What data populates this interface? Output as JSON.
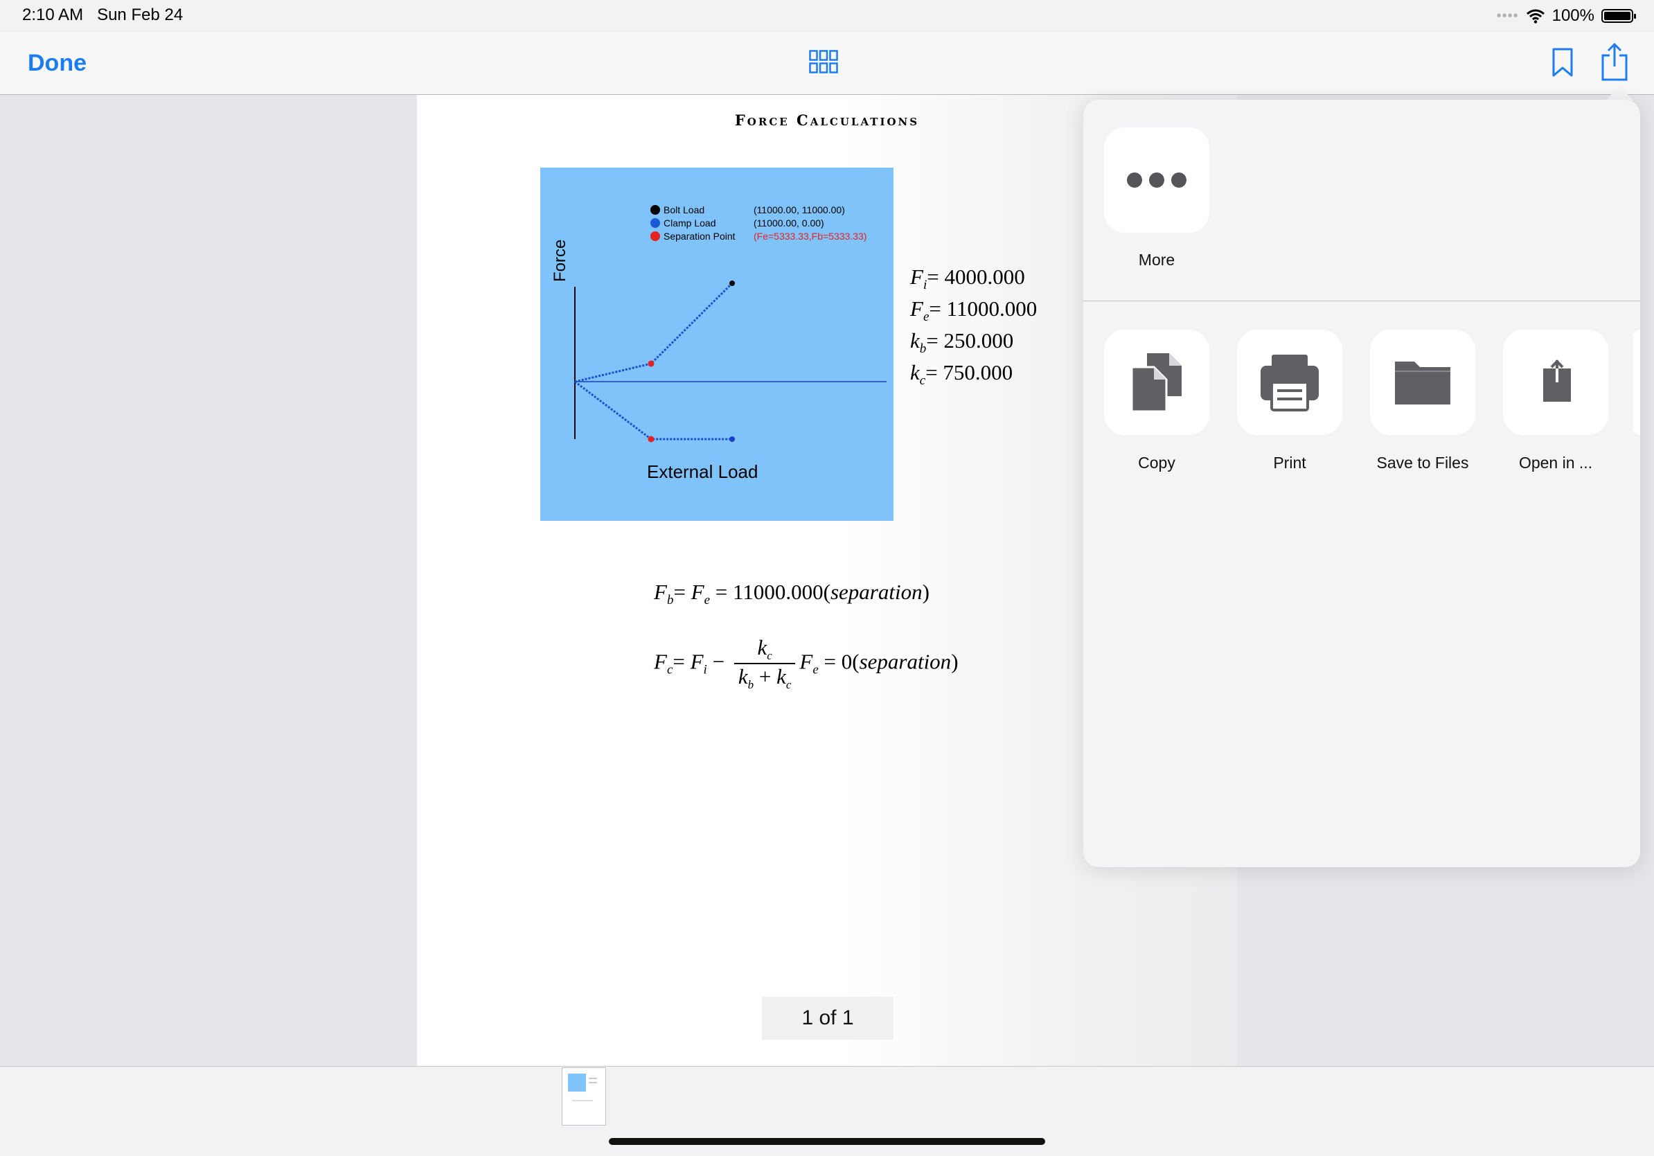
{
  "status": {
    "time": "2:10 AM",
    "date": "Sun Feb 24",
    "battery": "100%"
  },
  "nav": {
    "done": "Done",
    "icons": [
      "grid-icon",
      "bookmark-icon",
      "share-icon"
    ]
  },
  "doc": {
    "title": "Force Calculations",
    "plot": {
      "legend": [
        {
          "label": "Bolt Load",
          "value": "(11000.00, 11000.00)",
          "color": "#000000"
        },
        {
          "label": "Clamp Load",
          "value": "(11000.00, 0.00)",
          "color": "#1a5ad8"
        },
        {
          "label": "Separation Point",
          "value": "(Fe=5333.33,Fb=5333.33)",
          "color": "#e52222"
        }
      ],
      "y_label": "Force",
      "x_label": "External Load",
      "background": "#80c4fb"
    },
    "params": [
      {
        "sym": "F",
        "sub": "i",
        "value": "= 4000.000"
      },
      {
        "sym": "F",
        "sub": "e",
        "value": "= 11000.000"
      },
      {
        "sym": "k",
        "sub": "b",
        "value": "= 250.000"
      },
      {
        "sym": "k",
        "sub": "c",
        "value": "= 750.000"
      }
    ],
    "eq_fb": {
      "rhs": "= 11000.000(",
      "note": "separation",
      "close": ")"
    },
    "eq_fc": {
      "minus": "−",
      "plus": "+",
      "rhs": "= 0(",
      "note": "separation",
      "close": ")"
    },
    "page_indicator": "1 of 1"
  },
  "share": {
    "more": "More",
    "actions": [
      {
        "label": "Copy",
        "icon": "copy-icon"
      },
      {
        "label": "Print",
        "icon": "print-icon"
      },
      {
        "label": "Save to Files",
        "icon": "folder-icon"
      },
      {
        "label": "Open in ...",
        "icon": "open-in-icon"
      }
    ]
  }
}
